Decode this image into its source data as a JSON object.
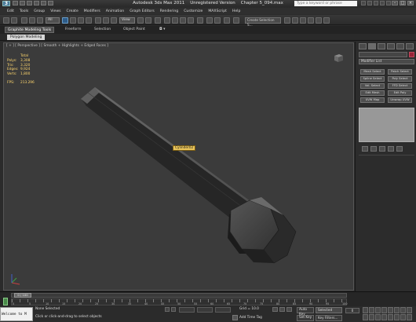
{
  "title": {
    "app_name": "Autodesk 3ds Max  2011",
    "version": "Unregistered Version",
    "filename": "Chapter 5_094.max",
    "search_placeholder": "Type a keyword or phrase"
  },
  "menu": [
    "Edit",
    "Tools",
    "Group",
    "Views",
    "Create",
    "Modifiers",
    "Animation",
    "Graph Editors",
    "Rendering",
    "Customize",
    "MAXScript",
    "Help"
  ],
  "toolbar": {
    "filter_value": "View",
    "selection_set": "Create Selection S..."
  },
  "ribbon": {
    "tabs": [
      "Graphite Modeling Tools",
      "Freeform",
      "Selection",
      "Object Paint"
    ],
    "active_panel": "Polygon Modeling"
  },
  "viewport": {
    "label": "[ + ] [ Perspective ] [ Smooth + Highlights + Edged Faces ]",
    "stats": {
      "header": "Total",
      "polys_label": "Polys:",
      "polys": "3,308",
      "tris_label": "Tris:",
      "tris": "3,320",
      "edges_label": "Edges:",
      "edges": "9,924",
      "verts_label": "Verts:",
      "verts": "1,800",
      "fps_label": "FPS:",
      "fps": "213.296"
    },
    "object_tag": "Cylinder02"
  },
  "command_panel": {
    "modifier_list": "Modifier List",
    "buttons": [
      "Mesh Select",
      "Patch Select",
      "Spline Select",
      "Poly Select",
      "Vol. Select",
      "FFD Select",
      "Edit Mesh",
      "Edit Poly",
      "UVW Map",
      "Unwrap UVW"
    ],
    "name_color": "#9a2438"
  },
  "timeline": {
    "position": "0 / 100",
    "ticks": [
      "0",
      "5",
      "10",
      "15",
      "20",
      "25",
      "30",
      "35",
      "40",
      "45",
      "50",
      "55",
      "60",
      "65",
      "70",
      "75",
      "80",
      "85",
      "90",
      "95",
      "100"
    ]
  },
  "status": {
    "maxscript_text": "Welcome to M",
    "selection": "None Selected",
    "prompt": "Click or click-and-drag to select objects",
    "grid": "Grid = 10.0",
    "add_time_tag": "Add Time Tag",
    "auto_key": "Auto Key",
    "selected": "Selected",
    "set_key": "Set Key",
    "key_filters": "Key Filters...",
    "frame": "0"
  }
}
